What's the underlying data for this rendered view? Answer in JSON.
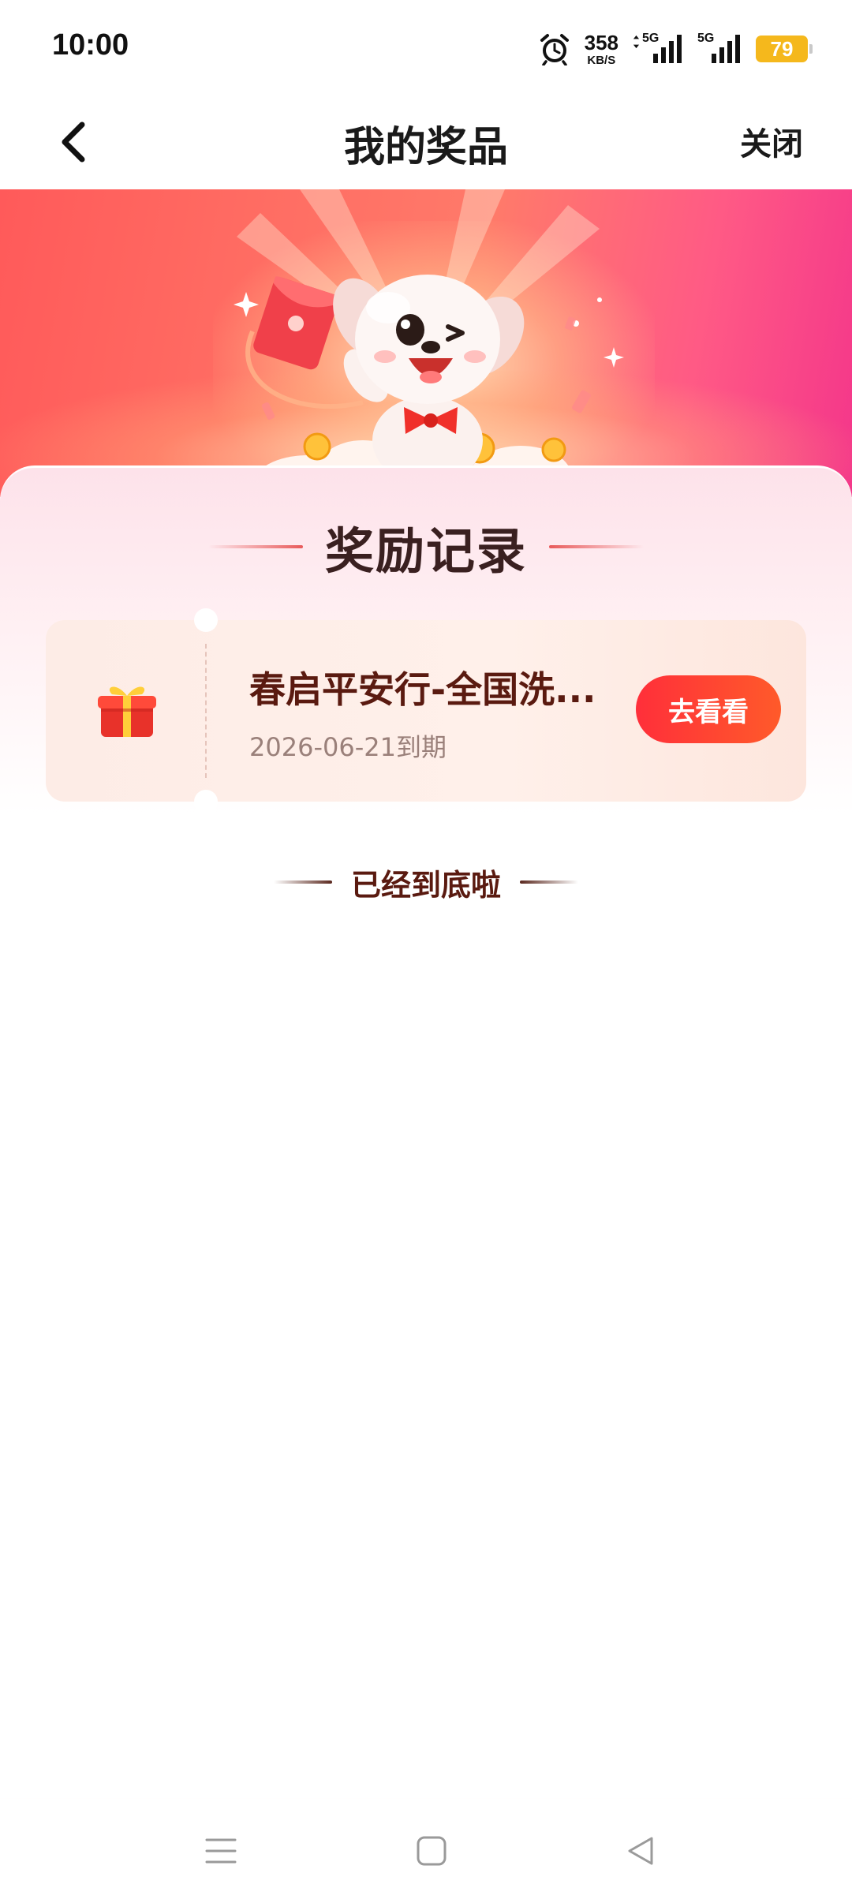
{
  "status_bar": {
    "time": "10:00",
    "net_speed_value": "358",
    "net_speed_unit": "KB/S",
    "signal1_label": "5G",
    "signal2_label": "5G",
    "battery_level": "79",
    "icons": [
      "alarm-icon",
      "data-arrows-icon",
      "signal-icon",
      "signal-icon",
      "battery-icon"
    ]
  },
  "header": {
    "title": "我的奖品",
    "close_label": "关闭",
    "back_icon": "chevron-left-icon"
  },
  "section": {
    "title": "奖励记录"
  },
  "rewards": [
    {
      "icon": "gift-box-icon",
      "name": "春启平安行-全国洗...",
      "expiry": "2026-06-21到期",
      "action_label": "去看看"
    }
  ],
  "list_end_text": "已经到底啦",
  "nav_bar": {
    "icons": [
      "menu-icon",
      "home-icon",
      "back-triangle-icon"
    ]
  },
  "colors": {
    "accent": "#ff2f3a",
    "banner_left": "#ff5a5a",
    "banner_right": "#f4368a",
    "battery": "#f5b81c",
    "reward_text": "#5a1a10"
  }
}
